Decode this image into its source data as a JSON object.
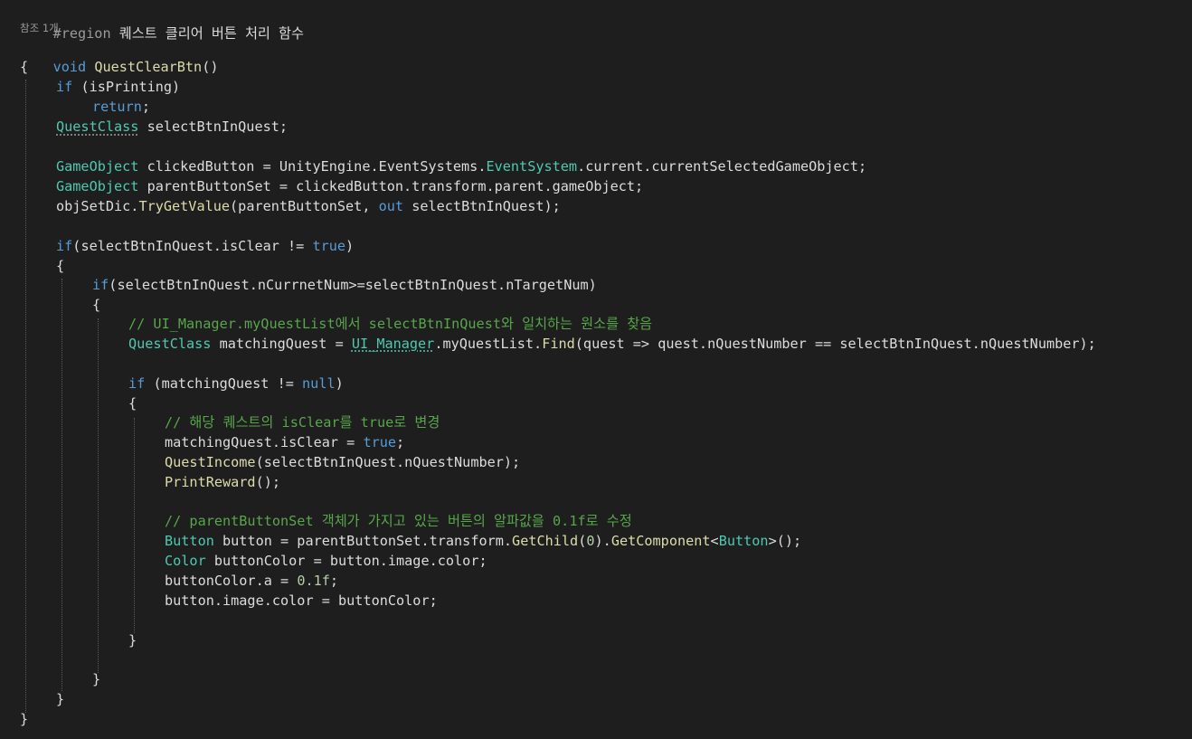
{
  "region": {
    "directive": "#region",
    "title": "퀘스트 클리어 버튼 처리 함수"
  },
  "references": "참조 1개",
  "method": {
    "ret": "void",
    "name": "QuestClearBtn",
    "parens": "()"
  },
  "code": {
    "l1_kw": "if",
    "l1_rest": " (isPrinting)",
    "l2_kw": "return",
    "l2_rest": ";",
    "l3_type": "QuestClass",
    "l3_rest": " selectBtnInQuest;",
    "l5_type": "GameObject",
    "l5_a": " clickedButton = UnityEngine.EventSystems.",
    "l5_type2": "EventSystem",
    "l5_b": ".current.currentSelectedGameObject;",
    "l6_type": "GameObject",
    "l6_rest": " parentButtonSet = clickedButton.transform.parent.gameObject;",
    "l7_a": "objSetDic.",
    "l7_fn": "TryGetValue",
    "l7_b": "(parentButtonSet, ",
    "l7_kw": "out",
    "l7_c": " selectBtnInQuest);",
    "l9_kw": "if",
    "l9_a": "(selectBtnInQuest.isClear != ",
    "l9_kw2": "true",
    "l9_b": ")",
    "l11_kw": "if",
    "l11_rest": "(selectBtnInQuest.nCurrnetNum>=selectBtnInQuest.nTargetNum)",
    "l13_comment": "// UI_Manager.myQuestList에서 selectBtnInQuest와 일치하는 원소를 찾음",
    "l14_type": "QuestClass",
    "l14_a": " matchingQuest = ",
    "l14_type2": "UI_Manager",
    "l14_b": ".myQuestList.",
    "l14_fn": "Find",
    "l14_c": "(quest => quest.nQuestNumber == selectBtnInQuest.nQuestNumber);",
    "l16_kw": "if",
    "l16_a": " (matchingQuest != ",
    "l16_kw2": "null",
    "l16_b": ")",
    "l18_comment": "// 해당 퀘스트의 isClear를 true로 변경",
    "l19_a": "matchingQuest.isClear = ",
    "l19_kw": "true",
    "l19_b": ";",
    "l20_fn": "QuestIncome",
    "l20_rest": "(selectBtnInQuest.nQuestNumber);",
    "l21_fn": "PrintReward",
    "l21_rest": "();",
    "l23_comment": "// parentButtonSet 객체가 가지고 있는 버튼의 알파값을 0.1f로 수정",
    "l24_type": "Button",
    "l24_a": " button = parentButtonSet.transform.",
    "l24_fn": "GetChild",
    "l24_b": "(",
    "l24_num": "0",
    "l24_c": ").",
    "l24_fn2": "GetComponent",
    "l24_d": "<",
    "l24_type2": "Button",
    "l24_e": ">();",
    "l25_type": "Color",
    "l25_rest": " buttonColor = button.image.color;",
    "l26_a": "buttonColor.a = ",
    "l26_num": "0.1f",
    "l26_b": ";",
    "l27": "button.image.color = buttonColor;",
    "open": "{",
    "close": "}"
  }
}
